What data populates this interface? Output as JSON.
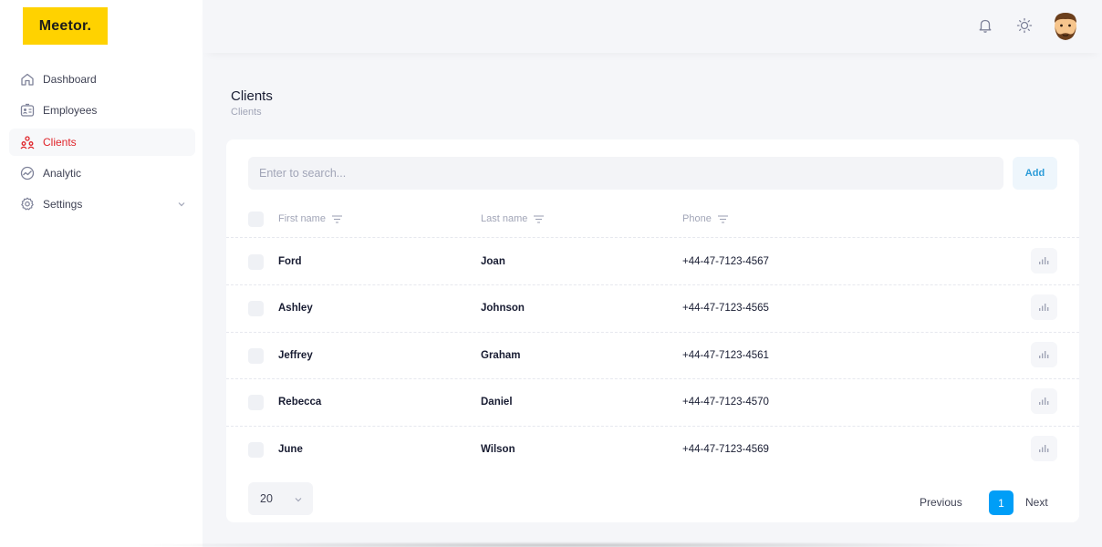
{
  "app": {
    "logo_text": "Meetor."
  },
  "sidebar": {
    "items": [
      {
        "label": "Dashboard",
        "icon": "home-icon"
      },
      {
        "label": "Employees",
        "icon": "id-card-icon"
      },
      {
        "label": "Clients",
        "icon": "users-icon",
        "active": true
      },
      {
        "label": "Analytic",
        "icon": "chart-circle-icon"
      },
      {
        "label": "Settings",
        "icon": "gear-icon",
        "has_submenu": true
      }
    ]
  },
  "header": {
    "icons": [
      "bell-icon",
      "sun-icon",
      "avatar"
    ]
  },
  "page": {
    "title": "Clients",
    "breadcrumb": "Clients"
  },
  "toolbar": {
    "search_placeholder": "Enter to search...",
    "add_label": "Add"
  },
  "table": {
    "columns": [
      "First name",
      "Last name",
      "Phone"
    ],
    "rows": [
      {
        "first": "Ford",
        "last": "Joan",
        "phone": "+44-47-7123-4567"
      },
      {
        "first": "Ashley",
        "last": "Johnson",
        "phone": "+44-47-7123-4565"
      },
      {
        "first": "Jeffrey",
        "last": "Graham",
        "phone": "+44-47-7123-4561"
      },
      {
        "first": "Rebecca",
        "last": "Daniel",
        "phone": "+44-47-7123-4570"
      },
      {
        "first": "June",
        "last": "Wilson",
        "phone": "+44-47-7123-4569"
      }
    ]
  },
  "pagination": {
    "page_size": "20",
    "previous_label": "Previous",
    "current_page": "1",
    "next_label": "Next"
  },
  "colors": {
    "brand": "#ffd200",
    "active_nav": "#e0252b",
    "primary": "#009ef7"
  }
}
